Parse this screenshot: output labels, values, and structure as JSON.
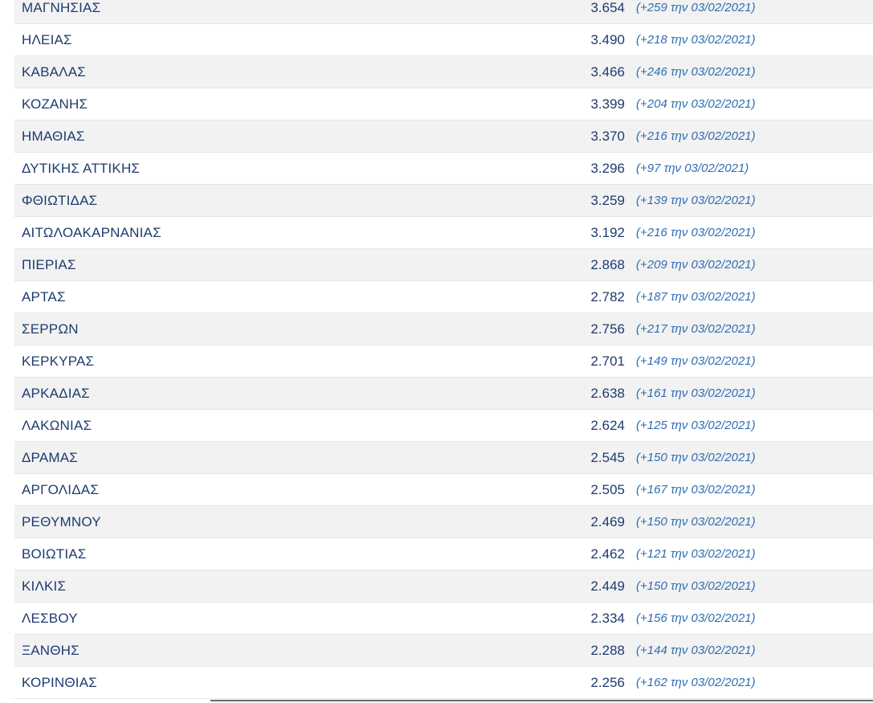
{
  "rows": [
    {
      "name": "ΜΑΓΝΗΣΙΑΣ",
      "value": "3.654",
      "delta": "(+259 την 03/02/2021)"
    },
    {
      "name": "ΗΛΕΙΑΣ",
      "value": "3.490",
      "delta": "(+218 την 03/02/2021)"
    },
    {
      "name": "ΚΑΒΑΛΑΣ",
      "value": "3.466",
      "delta": "(+246 την 03/02/2021)"
    },
    {
      "name": "ΚΟΖΑΝΗΣ",
      "value": "3.399",
      "delta": "(+204 την 03/02/2021)"
    },
    {
      "name": "ΗΜΑΘΙΑΣ",
      "value": "3.370",
      "delta": "(+216 την 03/02/2021)"
    },
    {
      "name": "ΔΥΤΙΚΗΣ ΑΤΤΙΚΗΣ",
      "value": "3.296",
      "delta": "(+97 την 03/02/2021)"
    },
    {
      "name": "ΦΘΙΩΤΙΔΑΣ",
      "value": "3.259",
      "delta": "(+139 την 03/02/2021)"
    },
    {
      "name": "ΑΙΤΩΛΟΑΚΑΡΝΑΝΙΑΣ",
      "value": "3.192",
      "delta": "(+216 την 03/02/2021)"
    },
    {
      "name": "ΠΙΕΡΙΑΣ",
      "value": "2.868",
      "delta": "(+209 την 03/02/2021)"
    },
    {
      "name": "ΑΡΤΑΣ",
      "value": "2.782",
      "delta": "(+187 την 03/02/2021)"
    },
    {
      "name": "ΣΕΡΡΩΝ",
      "value": "2.756",
      "delta": "(+217 την 03/02/2021)"
    },
    {
      "name": "ΚΕΡΚΥΡΑΣ",
      "value": "2.701",
      "delta": "(+149 την 03/02/2021)"
    },
    {
      "name": "ΑΡΚΑΔΙΑΣ",
      "value": "2.638",
      "delta": "(+161 την 03/02/2021)"
    },
    {
      "name": "ΛΑΚΩΝΙΑΣ",
      "value": "2.624",
      "delta": "(+125 την 03/02/2021)"
    },
    {
      "name": "ΔΡΑΜΑΣ",
      "value": "2.545",
      "delta": "(+150 την 03/02/2021)"
    },
    {
      "name": "ΑΡΓΟΛΙΔΑΣ",
      "value": "2.505",
      "delta": "(+167 την 03/02/2021)"
    },
    {
      "name": "ΡΕΘΥΜΝΟΥ",
      "value": "2.469",
      "delta": "(+150 την 03/02/2021)"
    },
    {
      "name": "ΒΟΙΩΤΙΑΣ",
      "value": "2.462",
      "delta": "(+121 την 03/02/2021)"
    },
    {
      "name": "ΚΙΛΚΙΣ",
      "value": "2.449",
      "delta": "(+150 την 03/02/2021)"
    },
    {
      "name": "ΛΕΣΒΟΥ",
      "value": "2.334",
      "delta": "(+156 την 03/02/2021)"
    },
    {
      "name": "ΞΑΝΘΗΣ",
      "value": "2.288",
      "delta": "(+144 την 03/02/2021)"
    },
    {
      "name": "ΚΟΡΙΝΘΙΑΣ",
      "value": "2.256",
      "delta": "(+162 την 03/02/2021)"
    }
  ]
}
